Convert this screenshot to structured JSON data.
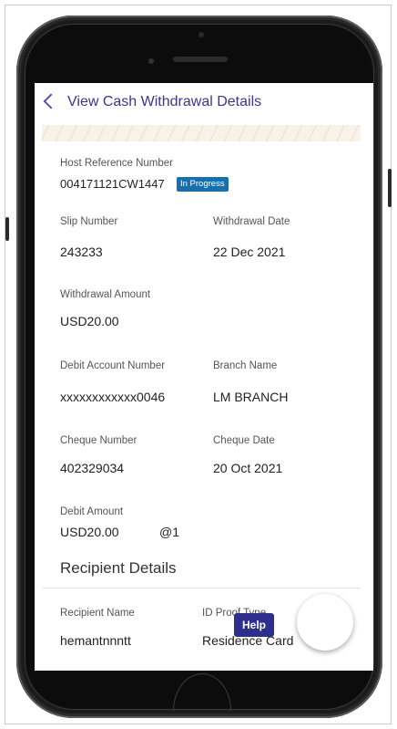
{
  "header": {
    "title": "View Cash Withdrawal Details"
  },
  "details": {
    "host_ref_label": "Host Reference Number",
    "host_ref_value": "004171121CW1447",
    "status": "In Progress",
    "slip_label": "Slip Number",
    "slip_value": "243233",
    "withdrawal_date_label": "Withdrawal Date",
    "withdrawal_date_value": "22 Dec 2021",
    "withdrawal_amount_label": "Withdrawal Amount",
    "withdrawal_amount_value": "USD20.00",
    "debit_account_label": "Debit Account Number",
    "debit_account_value": "xxxxxxxxxxxx0046",
    "branch_label": "Branch Name",
    "branch_value": "LM BRANCH",
    "cheque_number_label": "Cheque Number",
    "cheque_number_value": "402329034",
    "cheque_date_label": "Cheque Date",
    "cheque_date_value": "20 Oct 2021",
    "debit_amount_label": "Debit Amount",
    "debit_amount_value": "USD20.00",
    "debit_amount_rate": "@1"
  },
  "recipient": {
    "section_title": "Recipient Details",
    "name_label": "Recipient Name",
    "name_value": "hemantnnntt",
    "id_proof_label": "ID Proof Type",
    "id_proof_value": "Residence Card"
  },
  "help": {
    "label": "Help"
  }
}
